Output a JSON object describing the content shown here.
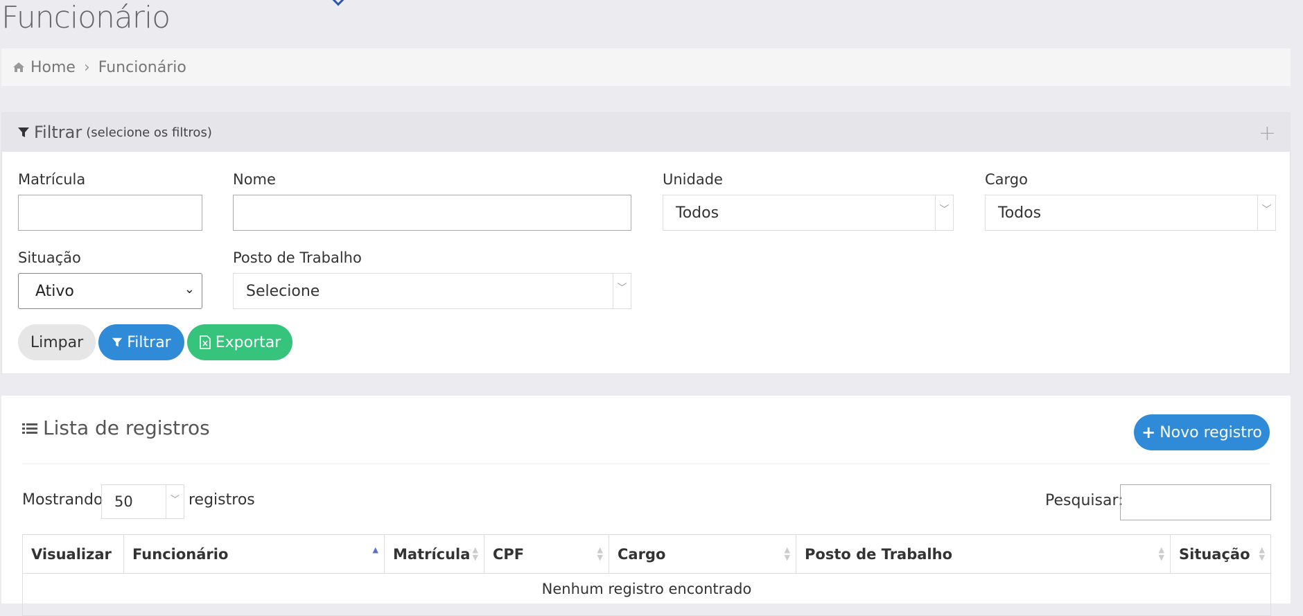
{
  "page": {
    "title": "Funcionário"
  },
  "breadcrumb": {
    "home": "Home",
    "current": "Funcionário"
  },
  "filter": {
    "title": "Filtrar",
    "subtitle": "(selecione os filtros)",
    "expand_icon": "plus-icon",
    "fields": {
      "matricula": {
        "label": "Matrícula",
        "value": ""
      },
      "nome": {
        "label": "Nome",
        "value": ""
      },
      "unidade": {
        "label": "Unidade",
        "value": "Todos"
      },
      "cargo": {
        "label": "Cargo",
        "value": "Todos"
      },
      "situacao": {
        "label": "Situação",
        "value": "Ativo"
      },
      "posto": {
        "label": "Posto de Trabalho",
        "value": "Selecione"
      }
    },
    "buttons": {
      "clear": "Limpar",
      "filter": "Filtrar",
      "export": "Exportar"
    }
  },
  "list": {
    "title": "Lista de registros",
    "new_button": "Novo registro",
    "show_prefix": "Mostrando",
    "per_page": "50",
    "show_suffix": "registros",
    "search_label": "Pesquisar:",
    "columns": [
      "Visualizar",
      "Funcionário",
      "Matrícula",
      "CPF",
      "Cargo",
      "Posto de Trabalho",
      "Situação"
    ],
    "sorted_column": "Funcionário",
    "empty_message": "Nenhum registro encontrado"
  },
  "colors": {
    "primary": "#2f8bd8",
    "success": "#36c37c",
    "background": "#ebebf0"
  }
}
